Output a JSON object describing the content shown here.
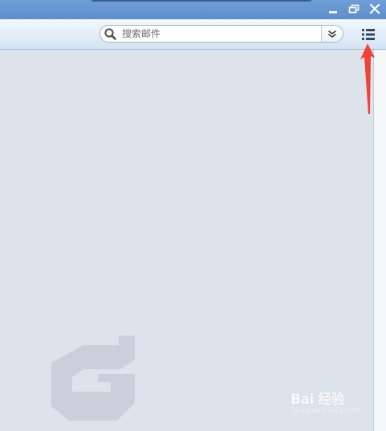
{
  "window": {
    "controls": {
      "minimize_icon": "minimize-icon",
      "restore_icon": "restore-icon",
      "close_icon": "close-icon"
    }
  },
  "toolbar": {
    "search": {
      "placeholder": "搜索邮件",
      "value": "",
      "icon": "search-icon",
      "options_icon": "double-chevron-down-icon"
    },
    "menu_icon": "list-menu-icon"
  },
  "content": {
    "logo": "client-logo-watermark"
  },
  "overlay": {
    "annotation": "red-arrow",
    "watermark": {
      "brand": "Bai 经验",
      "url": "jingyan.baidu.com"
    }
  },
  "colors": {
    "titlebar": "#6f9ed6",
    "toolbar_top": "#f3f8fd",
    "toolbar_bottom": "#d3e3f3",
    "content_bg": "#dde3ea",
    "annotation_red": "#f0403c"
  }
}
